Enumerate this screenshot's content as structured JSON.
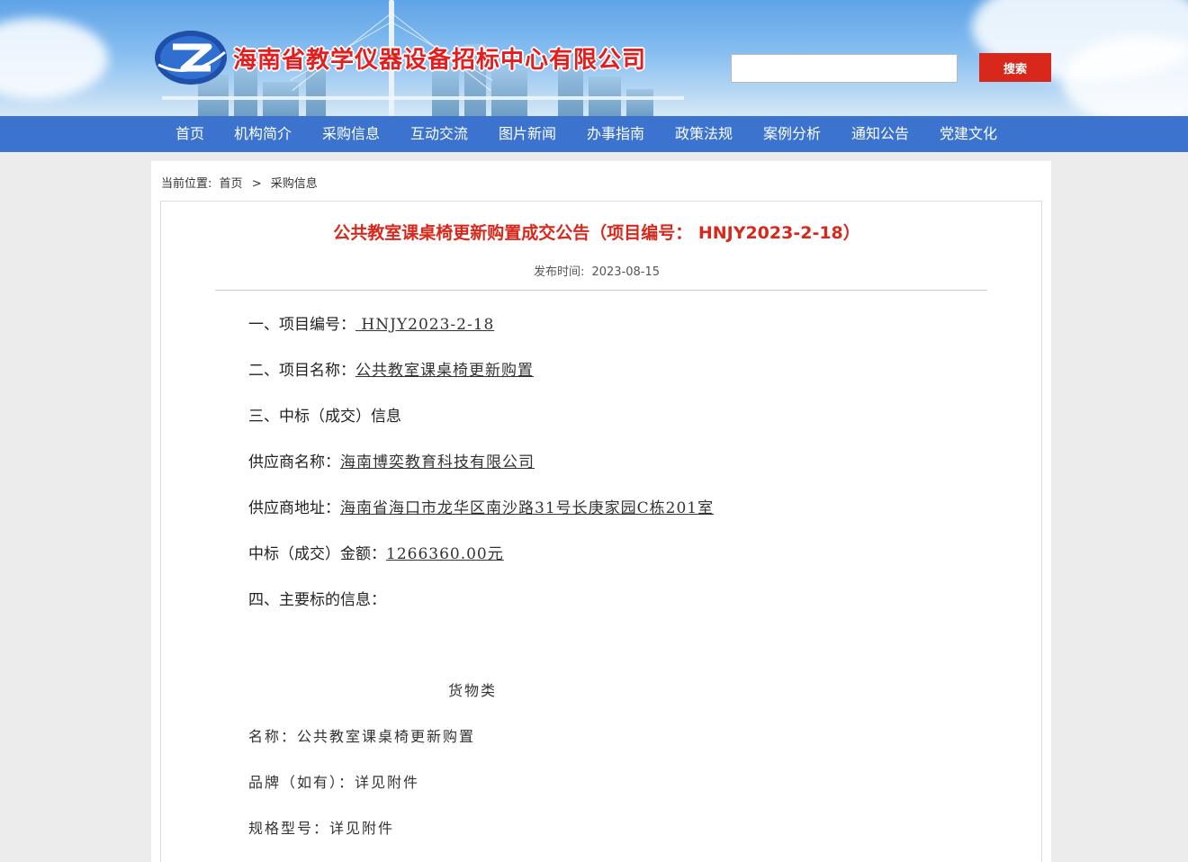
{
  "header": {
    "site_name": "海南省教学仪器设备招标中心有限公司",
    "search": {
      "value": "",
      "placeholder": ""
    },
    "search_button": "搜索"
  },
  "nav": {
    "items": [
      "首页",
      "机构简介",
      "采购信息",
      "互动交流",
      "图片新闻",
      "办事指南",
      "政策法规",
      "案例分析",
      "通知公告",
      "党建文化"
    ]
  },
  "breadcrumb": {
    "prefix": "当前位置:",
    "home": "首页",
    "separator": ">",
    "current": "采购信息"
  },
  "article": {
    "title": "公共教室课桌椅更新购置成交公告（项目编号： HNJY2023-2-18）",
    "publish_label": "发布时间:",
    "publish_date": "2023-08-15",
    "fields": {
      "project_no_label": "一、项目编号：",
      "project_no": " HNJY2023-2-18",
      "project_name_label": "二、项目名称：",
      "project_name": "公共教室课桌椅更新购置",
      "section3": "三、中标（成交）信息",
      "supplier_name_label": "供应商名称：",
      "supplier_name": "海南博奕教育科技有限公司",
      "supplier_addr_label": "供应商地址：",
      "supplier_addr": "海南省海口市龙华区南沙路31号长庚家园C栋201室",
      "amount_label": "中标（成交）金额：",
      "amount": "1266360.00元",
      "section4": "四、主要标的信息："
    },
    "goods": {
      "heading": "货物类",
      "name": "名称：公共教室课桌椅更新购置",
      "brand": "品牌（如有）：详见附件",
      "spec": "规格型号：详见附件"
    }
  }
}
